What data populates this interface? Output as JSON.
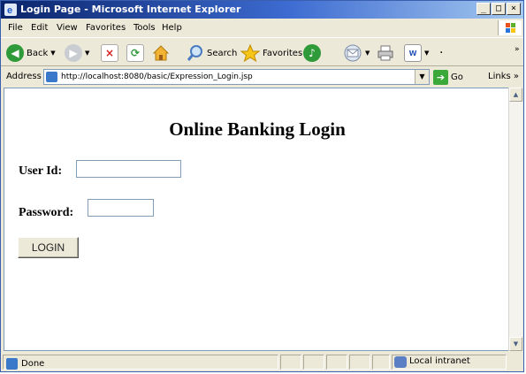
{
  "window": {
    "title": "Login Page - Microsoft Internet Explorer",
    "controls": {
      "minimize": "_",
      "maximize": "□",
      "close": "×"
    }
  },
  "menu": [
    "File",
    "Edit",
    "View",
    "Favorites",
    "Tools",
    "Help"
  ],
  "toolbar": {
    "back_label": "Back",
    "search_label": "Search",
    "favorites_label": "Favorites",
    "icons": [
      "back-arrow-icon",
      "forward-arrow-icon",
      "stop-icon",
      "refresh-icon",
      "home-icon",
      "search-icon",
      "favorites-star-icon",
      "media-icon",
      "mail-icon",
      "print-icon",
      "edit-icon"
    ]
  },
  "address": {
    "label": "Address",
    "url": "http://localhost:8080/basic/Expression_Login.jsp",
    "go_label": "Go",
    "links_label": "Links"
  },
  "page": {
    "heading": "Online Banking Login",
    "user_id_label": "User Id:",
    "user_id_value": "",
    "password_label": "Password:",
    "password_value": "",
    "login_button": "LOGIN"
  },
  "status": {
    "text": "Done",
    "zone": "Local intranet"
  },
  "colors": {
    "titlebar_start": "#0a246a",
    "titlebar_end": "#a6caf0",
    "chrome": "#ece9d8",
    "input_border": "#7f9db9"
  }
}
